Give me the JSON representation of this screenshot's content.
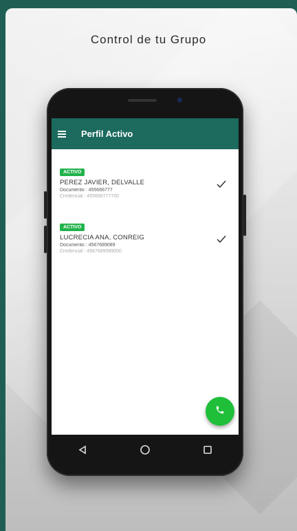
{
  "promo": {
    "headline": "Control de tu Grupo"
  },
  "app": {
    "title": "Perfil Activo"
  },
  "profiles": [
    {
      "badge": "ACTIVO",
      "name": "PEREZ JAVIER, DELVALLE",
      "documento": "Documento : 455666777",
      "credencial": "Credencial : 455666777700"
    },
    {
      "badge": "ACTIVO",
      "name": "LUCRECIA ANA, CONREIG",
      "documento": "Documento : 4567689089",
      "credencial": "Credencial : 4567689089000"
    }
  ],
  "icons": {
    "menu": "menu-icon",
    "check": "check-icon",
    "phone": "phone-icon",
    "back": "back-triangle-icon",
    "home": "home-circle-icon",
    "recents": "recents-square-icon"
  },
  "colors": {
    "background": "#1f5f53",
    "appbar": "#1c6b5e",
    "badge": "#22b24c",
    "fab": "#1fbf3a"
  }
}
